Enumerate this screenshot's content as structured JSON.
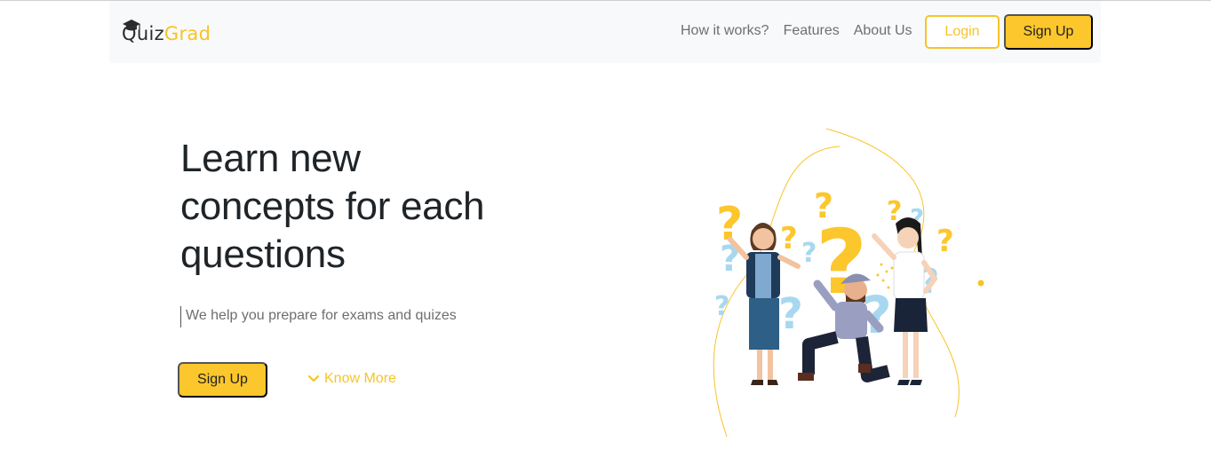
{
  "colors": {
    "accent": "#fcc72c",
    "accent_text": "#f7c427",
    "nav_background": "#f8f9fa",
    "heading": "#1f2428",
    "muted_text": "#6e6e6e",
    "light_blue": "#a7d8f0"
  },
  "brand": {
    "name_part1": "Quiz",
    "name_part2": "Grad",
    "icon": "graduation-cap-icon"
  },
  "nav": {
    "links": [
      {
        "label": "How it works?"
      },
      {
        "label": "Features"
      },
      {
        "label": "About Us"
      }
    ],
    "login_label": "Login",
    "signup_label": "Sign Up"
  },
  "hero": {
    "title_lines": [
      "Learn new",
      "concepts for each",
      "questions"
    ],
    "subtitle": "We help you prepare for exams and quizes",
    "signup_label": "Sign Up",
    "know_more_label": "Know More",
    "know_more_icon": "chevron-down-icon",
    "illustration": "people-with-question-marks-illustration"
  }
}
